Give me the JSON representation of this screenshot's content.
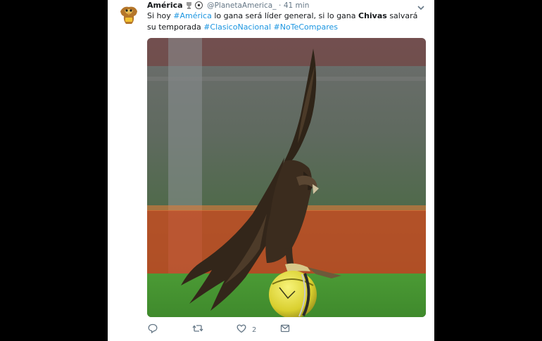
{
  "tweet": {
    "name": "América",
    "handle": "@PlanetaAmerica_",
    "separator": "·",
    "time": "41 min",
    "text": {
      "t1": "Si hoy ",
      "tag1": "#América",
      "t2": " lo gana será líder general, si lo gana ",
      "bold": "Chivas",
      "t3": " salvará su temporada ",
      "tag2": "#ClasicoNacional",
      "t4": " ",
      "tag3": "#NoTeCompares"
    },
    "like_count": "2"
  },
  "colors": {
    "link": "#1b95e0",
    "text": "#14171a",
    "muted": "#657786",
    "background": "#000000",
    "card": "#ffffff"
  },
  "icons": [
    "caret-down-icon",
    "trophy-icon",
    "soccer-ball-icon",
    "reply-icon",
    "retweet-icon",
    "heart-icon",
    "direct-message-icon"
  ]
}
